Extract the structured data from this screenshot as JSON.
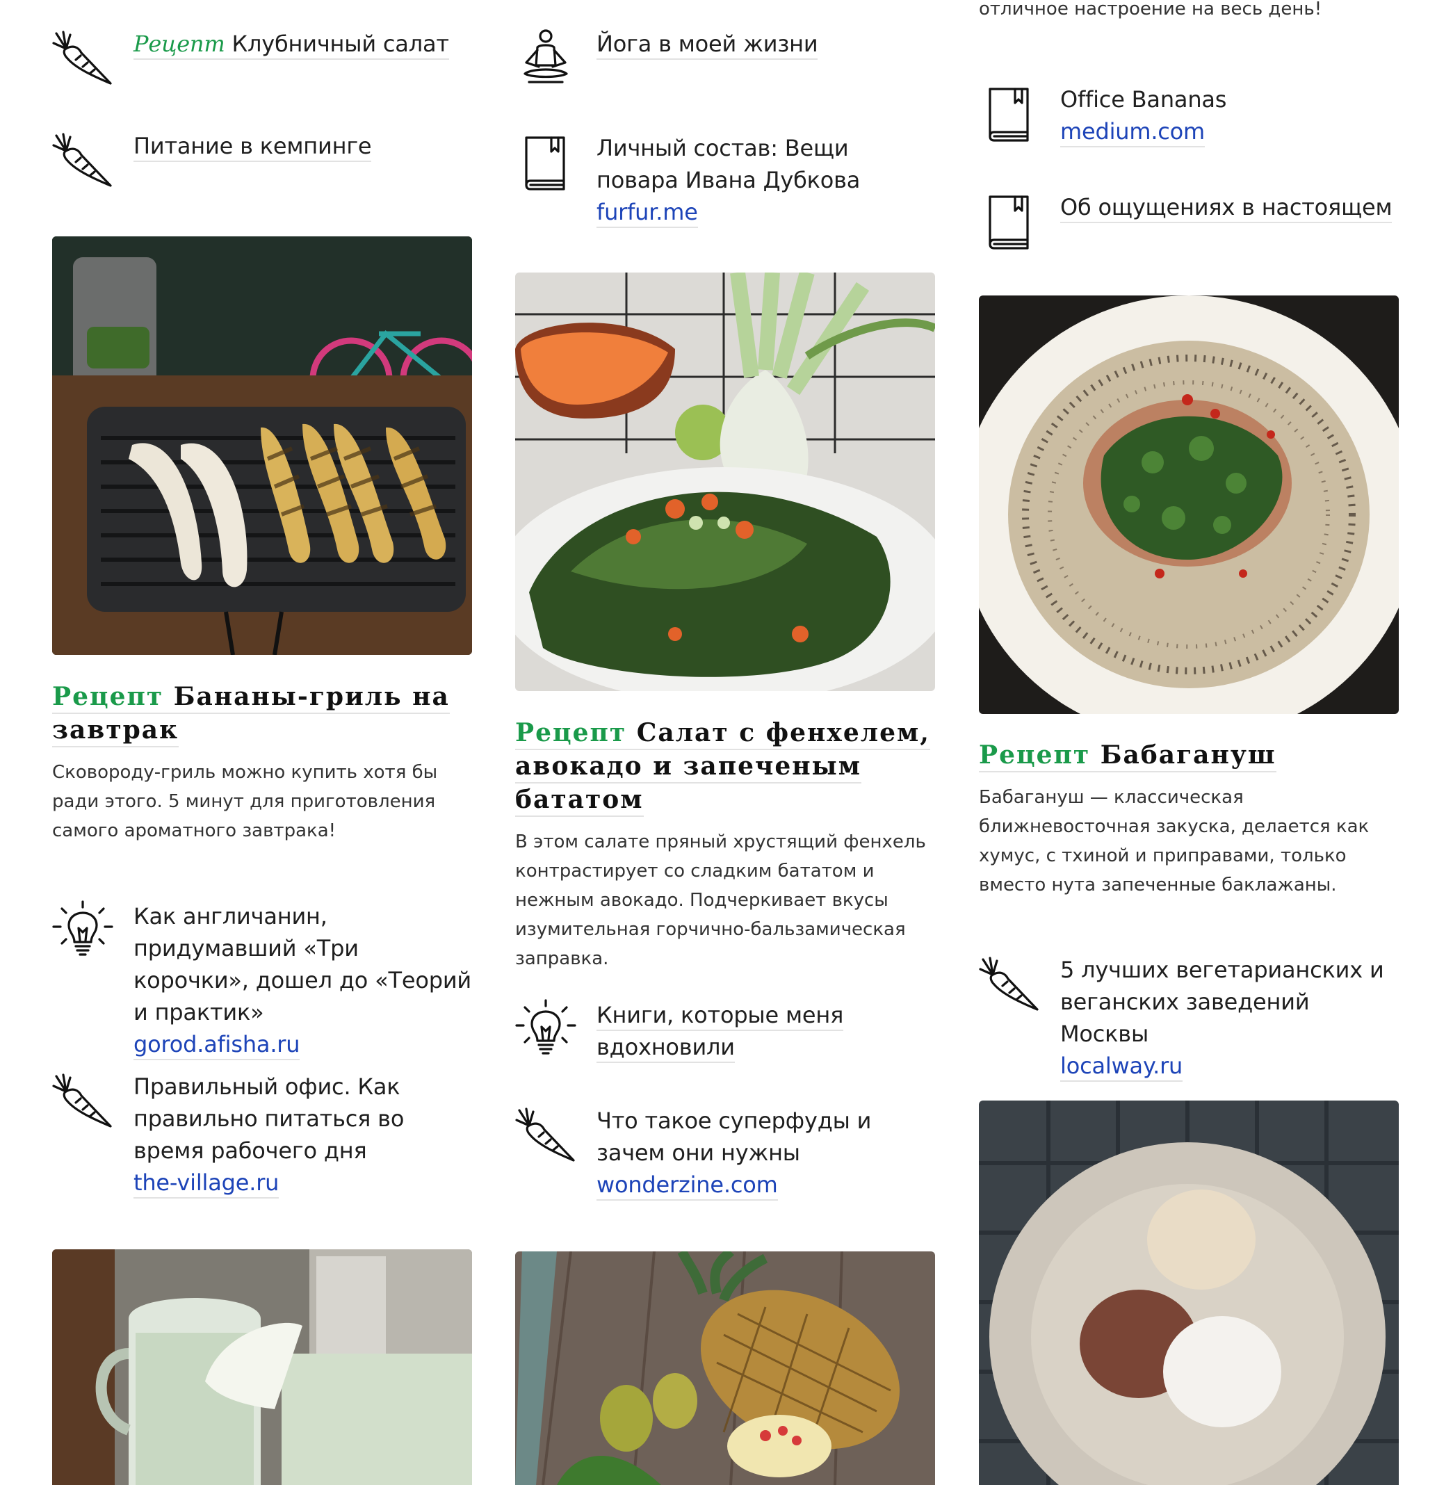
{
  "colors": {
    "accent_green": "#1a9a4a",
    "link_blue": "#1d44b8",
    "underline": "#e2e2e2"
  },
  "columns": [
    {
      "links": [
        {
          "icon": "carrot-icon",
          "label": "Рецепт",
          "title": "Клубничный салат"
        },
        {
          "icon": "carrot-icon",
          "title": "Питание в кемпинге"
        }
      ],
      "card": {
        "label": "Рецепт",
        "title": "Бананы-гриль на завтрак",
        "desc": "Сковороду-гриль можно купить хотя бы ради этого. 5 минут для приготовления самого ароматного завтрака!"
      },
      "links2": [
        {
          "icon": "lightbulb-icon",
          "title": "Как англичанин, придумавший «Три корочки», дошел до «Теорий и практик»",
          "source": "gorod.afisha.ru"
        },
        {
          "icon": "carrot-icon",
          "title": "Правильный офис. Как правильно питаться во время рабочего дня",
          "source": "the-village.ru"
        }
      ]
    },
    {
      "links": [
        {
          "icon": "yoga-icon",
          "title": "Йога в моей жизни"
        },
        {
          "icon": "book-icon",
          "title": "Личный состав: Вещи повара Ивана Дубкова",
          "source": "furfur.me"
        }
      ],
      "card": {
        "label": "Рецепт",
        "title": "Салат с фенхелем, авокадо и запеченым бататом",
        "desc": "В этом салате пряный хрустящий фенхель контрастирует со сладким бататом и нежным авокадо. Подчеркивает вкусы изумительная горчично-бальзамическая заправка."
      },
      "links2": [
        {
          "icon": "lightbulb-icon",
          "title": "Книги, которые меня вдохновили"
        },
        {
          "icon": "carrot-icon",
          "title": "Что такое суперфуды и зачем они нужны",
          "source": "wonderzine.com"
        }
      ]
    },
    {
      "top_text": "отличное настроение на весь день!",
      "links": [
        {
          "icon": "book-icon",
          "title": "Office Bananas",
          "source": "medium.com"
        },
        {
          "icon": "book-icon",
          "title": "Об ощущениях в настоящем"
        }
      ],
      "card": {
        "label": "Рецепт",
        "title": "Бабагануш",
        "desc": "Бабагануш — классическая ближневосточная закуска, делается как хумус, с тхиной и приправами, только вместо нута запеченные баклажаны."
      },
      "links2": [
        {
          "icon": "carrot-icon",
          "title": "5 лучших вегетарианских и веганских заведений Москвы",
          "source": "localway.ru"
        }
      ]
    }
  ]
}
